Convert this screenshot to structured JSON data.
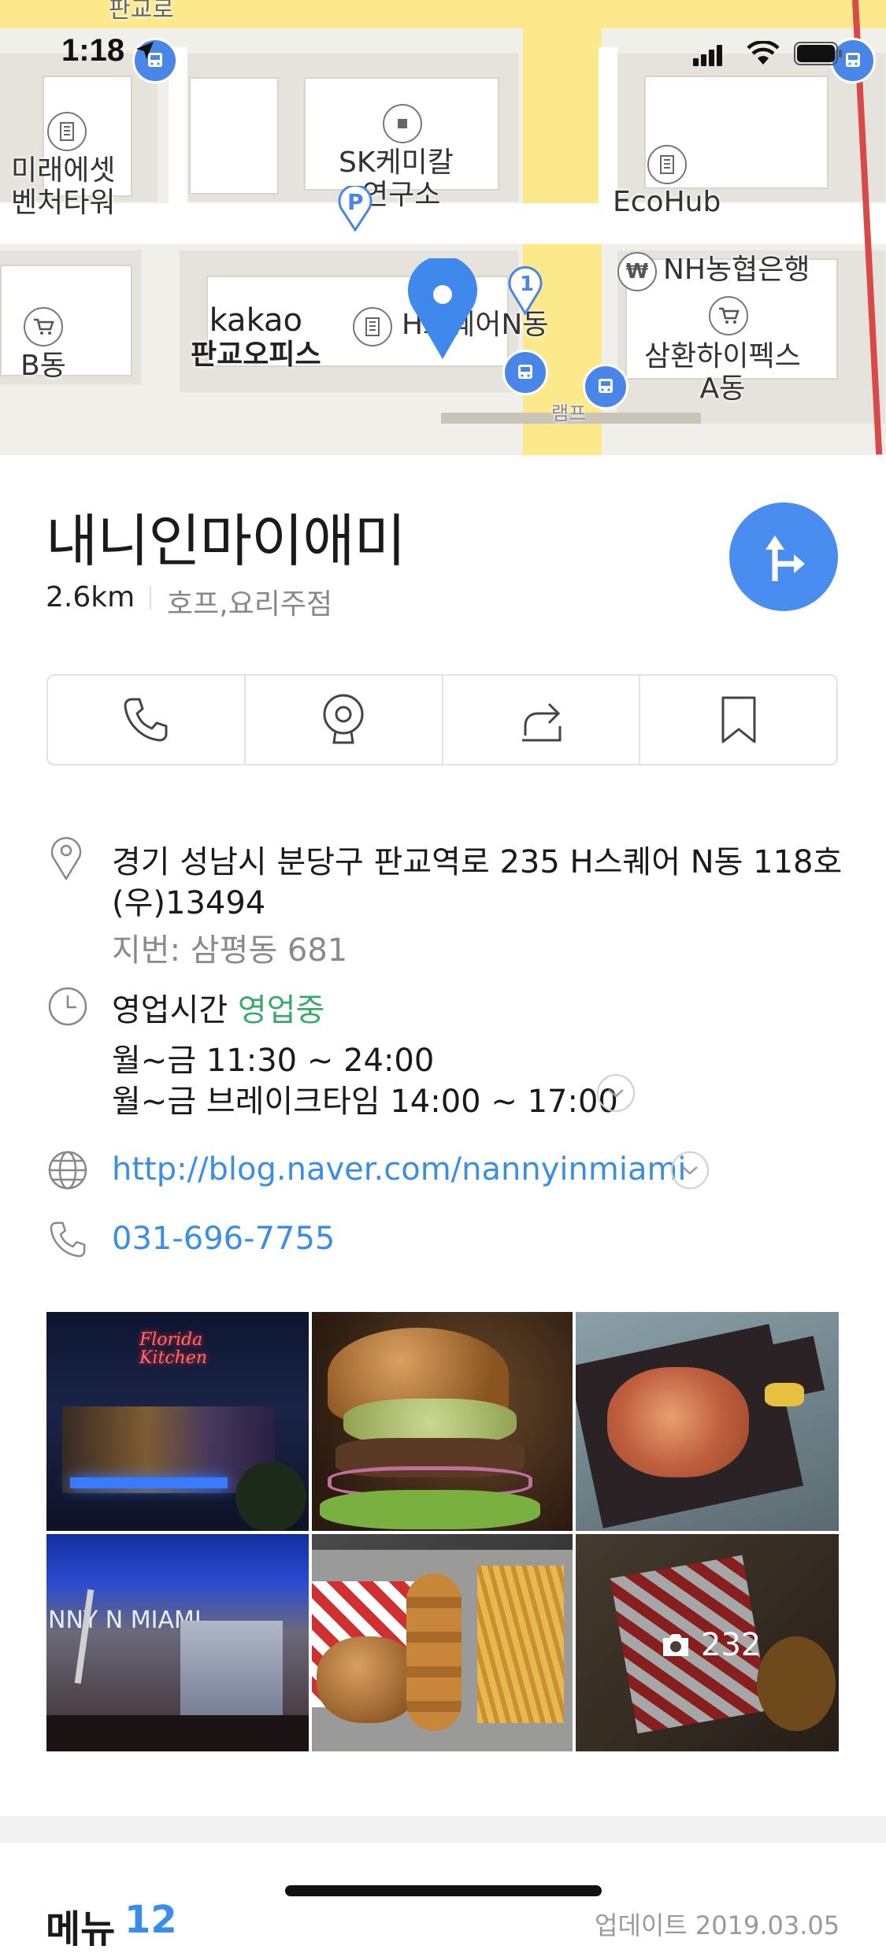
{
  "status_bar": {
    "time": "1:18"
  },
  "map": {
    "labels": {
      "pangyoro": "판교로",
      "mirae_line1": "미래에셋",
      "mirae_line2": "벤처타워",
      "sk_line1": "SK케미칼",
      "sk_line2": "연구소",
      "ecohub": "EcoHub",
      "nh": "NH농협은행",
      "kakao_line1": "kakao",
      "kakao_line2": "판교오피스",
      "hsquare": "H스퀘어N동",
      "samhwan_line1": "삼환하이펙스",
      "samhwan_line2": "A동",
      "b_dong": "B동",
      "parking": "P",
      "pin_num": "1",
      "won": "₩",
      "ramp": "램프"
    }
  },
  "place": {
    "title": "내니인마이애미",
    "distance": "2.6km",
    "category": "호프,요리주점"
  },
  "info": {
    "address": "경기 성남시 분당구 판교역로 235 H스퀘어 N동 118호",
    "postal": "(우)13494",
    "lot_address": "지번: 삼평동 681",
    "hours_label": "영업시간",
    "hours_status": "영업중",
    "hours_line1": "월~금 11:30 ~ 24:00",
    "hours_line2": "월~금 브레이크타임 14:00 ~ 17:00",
    "website": "http://blog.naver.com/nannyinmiami",
    "phone": "031-696-7755"
  },
  "photos": {
    "count": "232",
    "neon_sign": "Florida Kitchen",
    "mural_text": "NNY N MIAMI"
  },
  "next_section": {
    "menu_label": "메뉴",
    "menu_count": "12",
    "updated": "업데이트 2019.03.05"
  },
  "colors": {
    "accent": "#4a8df0",
    "link": "#3b8ee8",
    "open_green": "#3aaa6a"
  }
}
